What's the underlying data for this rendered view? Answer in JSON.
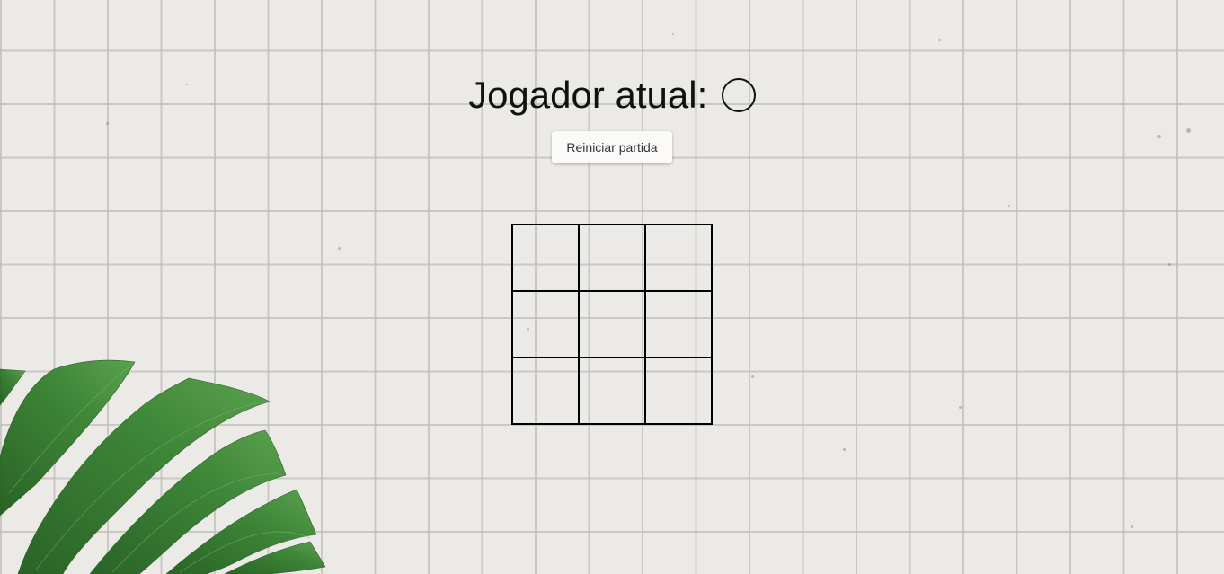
{
  "game": {
    "status_label": "Jogador atual:",
    "current_player": "O",
    "restart_label": "Reiniciar partida",
    "board": [
      "",
      "",
      "",
      "",
      "",
      "",
      "",
      "",
      ""
    ]
  },
  "colors": {
    "background": "#ebeae6",
    "grid_line": "#bebcb8",
    "leaf_dark": "#2f6e2a",
    "leaf_light": "#4f9a45"
  },
  "icons": {
    "current_player_symbol": "circle-icon",
    "decoration": "monstera-leaf-icon"
  }
}
